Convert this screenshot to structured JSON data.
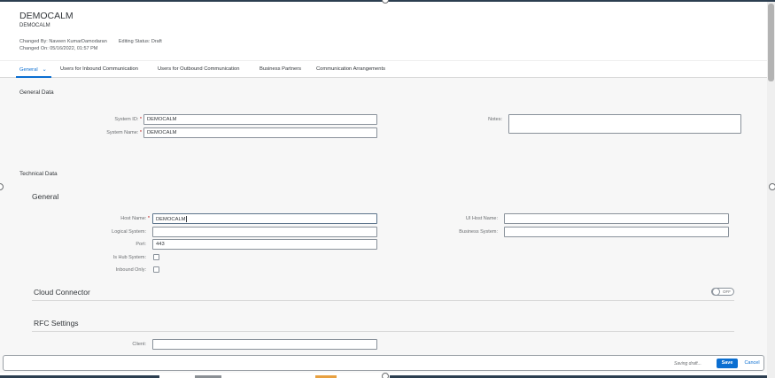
{
  "header": {
    "title": "DEMOCALM",
    "subtitle": "DEMOCALM",
    "changed_by_label": "Changed By:",
    "changed_by": "Naveen KumarDamodaran",
    "editing_status_label": "Editing Status:",
    "editing_status": "Draft",
    "changed_on_label": "Changed On:",
    "changed_on": "05/16/2022, 01:57 PM"
  },
  "tabs": [
    {
      "label": "General"
    },
    {
      "label": "Users for Inbound Communication"
    },
    {
      "label": "Users for Outbound Communication"
    },
    {
      "label": "Business Partners"
    },
    {
      "label": "Communication Arrangements"
    }
  ],
  "general_data": {
    "title": "General Data",
    "system_id_label": "System ID:",
    "system_id_value": "DEMOCALM",
    "system_name_label": "System Name:",
    "system_name_value": "DEMOCALM",
    "notes_label": "Notes:",
    "notes_value": ""
  },
  "technical_data": {
    "title": "Technical Data",
    "general_title": "General",
    "host_name_label": "Host Name:",
    "host_name_value": "DEMOCALM",
    "ui_host_name_label": "UI Host Name:",
    "ui_host_name_value": "",
    "logical_system_label": "Logical System:",
    "logical_system_value": "",
    "business_system_label": "Business System:",
    "business_system_value": "",
    "port_label": "Port:",
    "port_value": "443",
    "is_hub_system_label": "Is Hub System:",
    "inbound_only_label": "Inbound Only:",
    "required_marker": "*"
  },
  "cloud_connector": {
    "title": "Cloud Connector",
    "switch_state": "OFF"
  },
  "rfc_settings": {
    "title": "RFC Settings",
    "client_label": "Client:",
    "client_value": ""
  },
  "footer": {
    "saving_text": "Saving draft...",
    "save_label": "Save",
    "cancel_label": "Cancel"
  },
  "colors": {
    "accent": "#0a6ed1",
    "required": "#bb0000",
    "dark_edge": "#2c3e50"
  }
}
